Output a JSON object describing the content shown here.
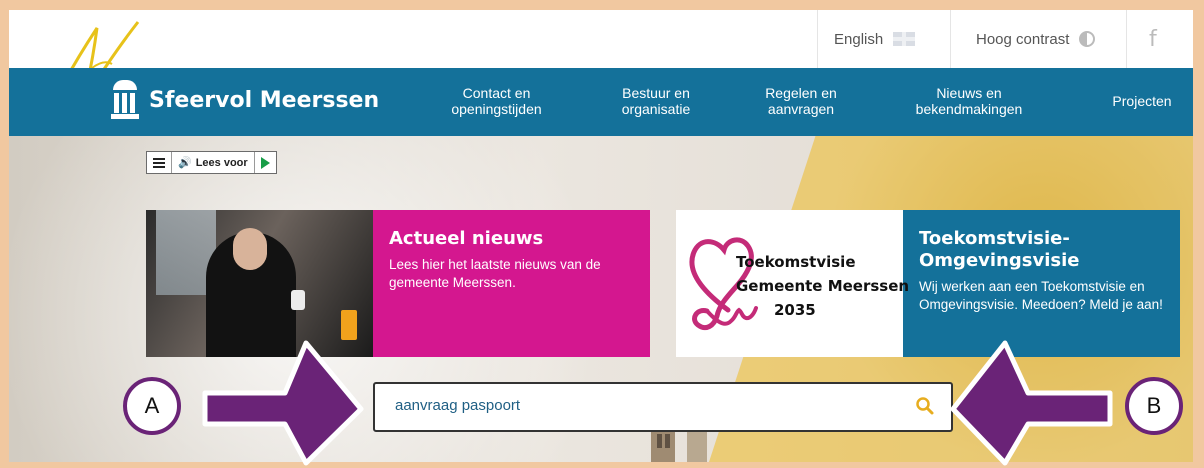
{
  "utility_bar": {
    "language": "English",
    "contrast": "Hoog contrast",
    "facebook_glyph": "f"
  },
  "nav": {
    "logo_text": "Sfeervol Meerssen",
    "items": [
      {
        "line1": "Contact en",
        "line2": "openingstijden"
      },
      {
        "line1": "Bestuur en",
        "line2": "organisatie"
      },
      {
        "line1": "Regelen en",
        "line2": "aanvragen"
      },
      {
        "line1": "Nieuws en",
        "line2": "bekendmakingen"
      },
      {
        "line1": "Projecten",
        "line2": ""
      }
    ]
  },
  "reader": {
    "label": "Lees voor"
  },
  "cards": [
    {
      "title": "Actueel nieuws",
      "text": "Lees hier het laatste nieuws van de gemeente Meerssen."
    },
    {
      "title_line1": "Toekomstvisie-",
      "title_line2": "Omgevingsvisie",
      "text": "Wij werken aan een Toekomstvisie en Omgevingsvisie. Meedoen? Meld je aan!",
      "visual_lines": [
        "Toekomstvisie",
        "Gemeente Meerssen",
        "2035"
      ]
    }
  ],
  "search": {
    "value": "aanvraag paspoort"
  },
  "annotations": {
    "left_label": "A",
    "right_label": "B"
  },
  "colors": {
    "nav_blue": "#14719a",
    "magenta": "#d4178f",
    "arrow_purple": "#6a2377",
    "frame": "#f1c8a0",
    "search_icon": "#e7ad1f"
  }
}
